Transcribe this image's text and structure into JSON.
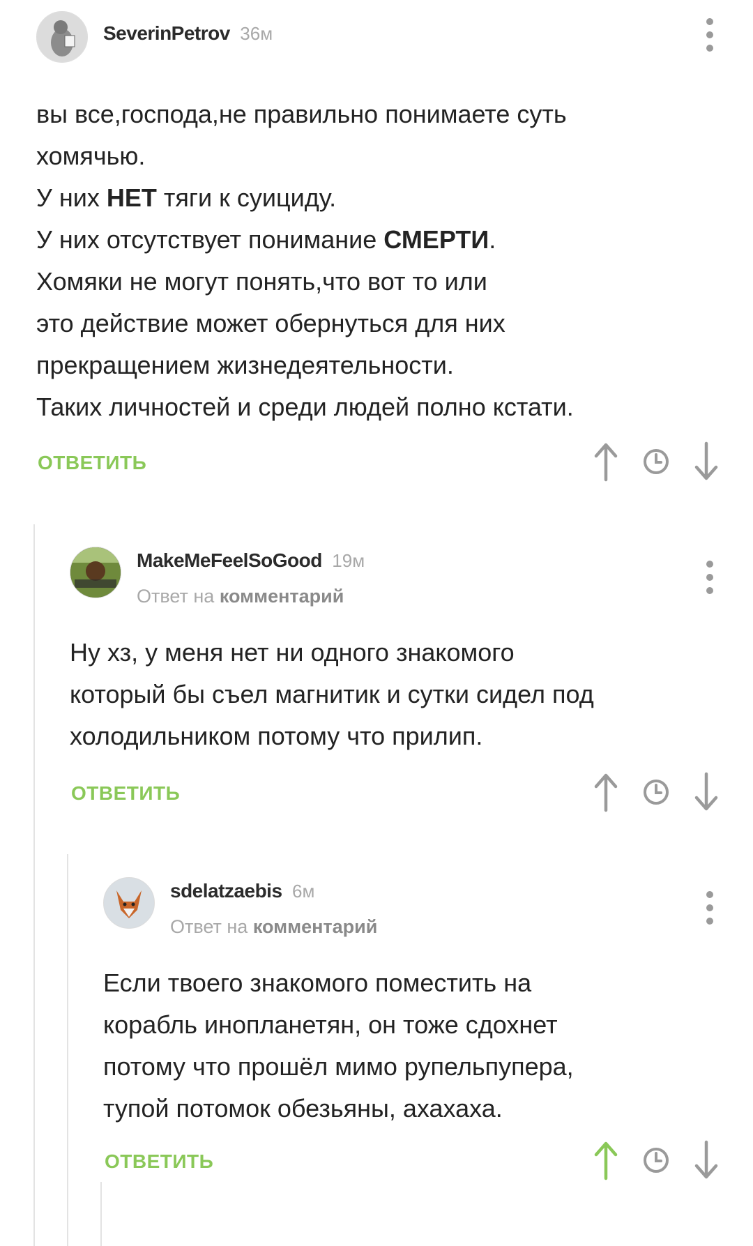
{
  "comments": [
    {
      "author": "SeverinPetrov",
      "time": "36м",
      "reply_to_prefix": "",
      "reply_to_link": "",
      "lines": [
        [
          {
            "t": "вы все,господа,не правильно понимаете суть",
            "b": false
          }
        ],
        [
          {
            "t": "хомячью.",
            "b": false
          }
        ],
        [
          {
            "t": "У них ",
            "b": false
          },
          {
            "t": "НЕТ",
            "b": true
          },
          {
            "t": " тяги к суициду.",
            "b": false
          }
        ],
        [
          {
            "t": "У них отсутствует понимание ",
            "b": false
          },
          {
            "t": "СМЕРТИ",
            "b": true
          },
          {
            "t": ".",
            "b": false
          }
        ],
        [
          {
            "t": "Хомяки не могут понять,что вот то или",
            "b": false
          }
        ],
        [
          {
            "t": "это действие может обернуться для них",
            "b": false
          }
        ],
        [
          {
            "t": "прекращением жизнедеятельности.",
            "b": false
          }
        ],
        [
          {
            "t": "Таких личностей и среди людей полно кстати.",
            "b": false
          }
        ]
      ],
      "reply_label": "ОТВЕТИТЬ",
      "upvoted": false
    },
    {
      "author": "MakeMeFeelSoGood",
      "time": "19м",
      "reply_to_prefix": "Ответ на ",
      "reply_to_link": "комментарий",
      "lines": [
        [
          {
            "t": "Ну хз, у меня нет ни одного знакомого",
            "b": false
          }
        ],
        [
          {
            "t": "который бы съел магнитик и сутки сидел под",
            "b": false
          }
        ],
        [
          {
            "t": "холодильником потому что прилип.",
            "b": false
          }
        ]
      ],
      "reply_label": "ОТВЕТИТЬ",
      "upvoted": false
    },
    {
      "author": "sdelatzaebis",
      "time": "6м",
      "reply_to_prefix": "Ответ на ",
      "reply_to_link": "комментарий",
      "lines": [
        [
          {
            "t": "Если твоего знакомого поместить на",
            "b": false
          }
        ],
        [
          {
            "t": "корабль инопланетян, он тоже сдохнет",
            "b": false
          }
        ],
        [
          {
            "t": "потому что прошёл мимо рупельпупера,",
            "b": false
          }
        ],
        [
          {
            "t": "тупой потомок обезьяны, ахахаха.",
            "b": false
          }
        ]
      ],
      "reply_label": "ОТВЕТИТЬ",
      "upvoted": true
    }
  ],
  "colors": {
    "accent": "#8ac858",
    "icon_gray": "#9a9a9a",
    "text": "#232323",
    "meta_gray": "#a8a8a8",
    "thread_line": "#e3e3e3"
  },
  "icons": [
    "more-vertical-icon",
    "arrow-up-icon",
    "clock-icon",
    "arrow-down-icon"
  ]
}
